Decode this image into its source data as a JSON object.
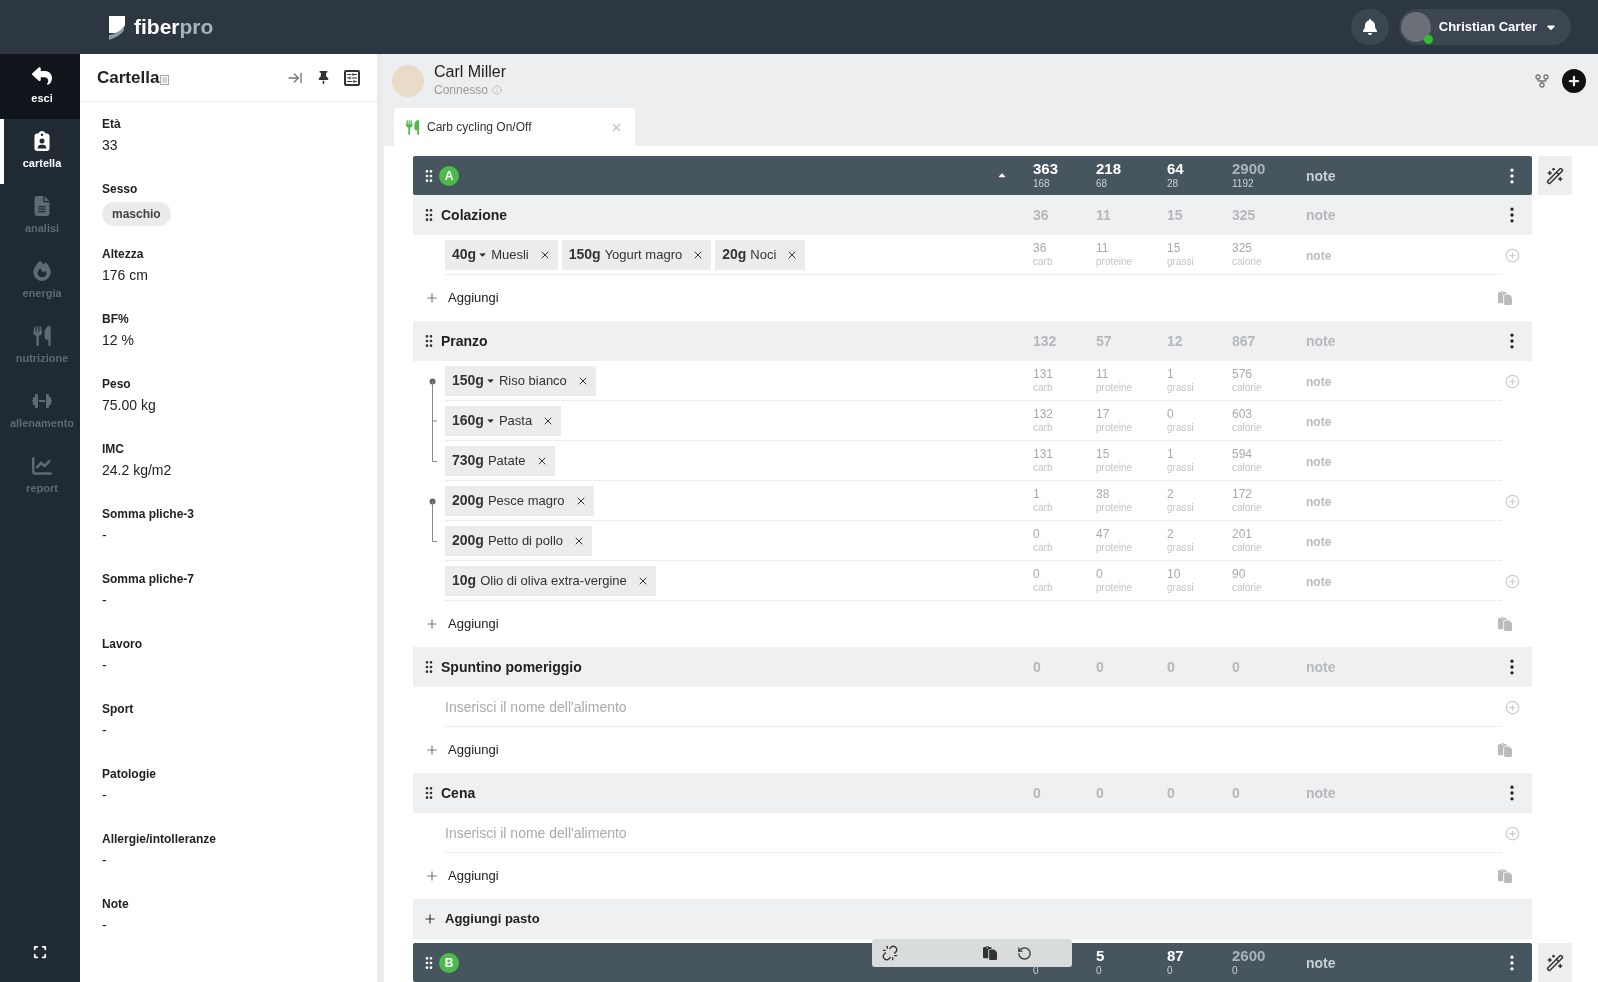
{
  "app": {
    "logo": "fiber",
    "logo_accent": "pro"
  },
  "user": {
    "name": "Christian Carter",
    "online": true
  },
  "nav": [
    {
      "label": "esci",
      "kind": "exit",
      "selected": false
    },
    {
      "label": "cartella",
      "kind": "record",
      "selected": true
    },
    {
      "label": "analisi",
      "kind": "analysis",
      "selected": false
    },
    {
      "label": "energia",
      "kind": "energy",
      "selected": false
    },
    {
      "label": "nutrizione",
      "kind": "nutrition",
      "selected": false
    },
    {
      "label": "allenamento",
      "kind": "training",
      "selected": false
    },
    {
      "label": "report",
      "kind": "report",
      "selected": false
    }
  ],
  "panel": {
    "title": "Cartella",
    "fields": [
      {
        "label": "Età",
        "value": "33"
      },
      {
        "label": "Sesso",
        "value": "maschio",
        "kind": "tag"
      },
      {
        "label": "Altezza",
        "value": "176 cm"
      },
      {
        "label": "BF%",
        "value": "12 %"
      },
      {
        "label": "Peso",
        "value": "75.00 kg"
      },
      {
        "label": "IMC",
        "value": "24.2 kg/m2"
      },
      {
        "label": "Somma pliche-3",
        "value": "-"
      },
      {
        "label": "Somma pliche-7",
        "value": "-"
      },
      {
        "label": "Lavoro",
        "value": "-"
      },
      {
        "label": "Sport",
        "value": "-"
      },
      {
        "label": "Patologie",
        "value": "-"
      },
      {
        "label": "Allergie/intolleranze",
        "value": "-"
      },
      {
        "label": "Note",
        "value": "-"
      }
    ]
  },
  "client": {
    "name": "Carl Miller",
    "status": "Connesso"
  },
  "tabs": [
    {
      "label": "Carb cycling On/Off",
      "selected": true
    }
  ],
  "plans": [
    {
      "letter": "A",
      "expanded": true,
      "note": "note",
      "totals": [
        {
          "value": "363",
          "sub": "168"
        },
        {
          "value": "218",
          "sub": "68"
        },
        {
          "value": "64",
          "sub": "28"
        },
        {
          "value": "2900",
          "sub": "1192",
          "kind": "calorie"
        }
      ],
      "meals": [
        {
          "name": "Colazione",
          "totals": [
            "36",
            "11",
            "15",
            "325"
          ],
          "note": "note",
          "add_label": "Aggiungi",
          "groups": [
            {
              "rows": [
                {
                  "chips": [
                    {
                      "qty": "40g",
                      "name": "Muesli",
                      "dropdown": true
                    },
                    {
                      "qty": "150g",
                      "name": "Yogurt magro",
                      "dropdown": false
                    },
                    {
                      "qty": "20g",
                      "name": "Noci",
                      "dropdown": false
                    }
                  ],
                  "note": "note",
                  "values": [
                    {
                      "value": "36",
                      "unit": "carb"
                    },
                    {
                      "value": "11",
                      "unit": "proteine"
                    },
                    {
                      "value": "15",
                      "unit": "grassi"
                    },
                    {
                      "value": "325",
                      "unit": "calorie"
                    }
                  ]
                }
              ]
            }
          ]
        },
        {
          "name": "Pranzo",
          "totals": [
            "132",
            "57",
            "12",
            "867"
          ],
          "note": "note",
          "add_label": "Aggiungi",
          "groups": [
            {
              "rows": [
                {
                  "chips": [
                    {
                      "qty": "150g",
                      "name": "Riso bianco",
                      "dropdown": true
                    }
                  ],
                  "note": "note",
                  "values": [
                    {
                      "value": "131",
                      "unit": "carb"
                    },
                    {
                      "value": "11",
                      "unit": "proteine"
                    },
                    {
                      "value": "1",
                      "unit": "grassi"
                    },
                    {
                      "value": "576",
                      "unit": "calorie"
                    }
                  ]
                },
                {
                  "chips": [
                    {
                      "qty": "160g",
                      "name": "Pasta",
                      "dropdown": true
                    }
                  ],
                  "note": "note",
                  "values": [
                    {
                      "value": "132",
                      "unit": "carb"
                    },
                    {
                      "value": "17",
                      "unit": "proteine"
                    },
                    {
                      "value": "0",
                      "unit": "grassi"
                    },
                    {
                      "value": "603",
                      "unit": "calorie"
                    }
                  ]
                },
                {
                  "chips": [
                    {
                      "qty": "730g",
                      "name": "Patate",
                      "dropdown": false
                    }
                  ],
                  "note": "note",
                  "values": [
                    {
                      "value": "131",
                      "unit": "carb"
                    },
                    {
                      "value": "15",
                      "unit": "proteine"
                    },
                    {
                      "value": "1",
                      "unit": "grassi"
                    },
                    {
                      "value": "594",
                      "unit": "calorie"
                    }
                  ]
                }
              ]
            },
            {
              "rows": [
                {
                  "chips": [
                    {
                      "qty": "200g",
                      "name": "Pesce magro",
                      "dropdown": false
                    }
                  ],
                  "note": "note",
                  "values": [
                    {
                      "value": "1",
                      "unit": "carb"
                    },
                    {
                      "value": "38",
                      "unit": "proteine"
                    },
                    {
                      "value": "2",
                      "unit": "grassi"
                    },
                    {
                      "value": "172",
                      "unit": "calorie"
                    }
                  ]
                },
                {
                  "chips": [
                    {
                      "qty": "200g",
                      "name": "Petto di pollo",
                      "dropdown": false
                    }
                  ],
                  "note": "note",
                  "values": [
                    {
                      "value": "0",
                      "unit": "carb"
                    },
                    {
                      "value": "47",
                      "unit": "proteine"
                    },
                    {
                      "value": "2",
                      "unit": "grassi"
                    },
                    {
                      "value": "201",
                      "unit": "calorie"
                    }
                  ]
                }
              ]
            },
            {
              "rows": [
                {
                  "chips": [
                    {
                      "qty": "10g",
                      "name": "Olio di oliva extra-vergine",
                      "dropdown": false
                    }
                  ],
                  "note": "note",
                  "values": [
                    {
                      "value": "0",
                      "unit": "carb"
                    },
                    {
                      "value": "0",
                      "unit": "proteine"
                    },
                    {
                      "value": "10",
                      "unit": "grassi"
                    },
                    {
                      "value": "90",
                      "unit": "calorie"
                    }
                  ]
                }
              ]
            }
          ]
        },
        {
          "name": "Spuntino pomeriggio",
          "totals": [
            "0",
            "0",
            "0",
            "0"
          ],
          "note": "note",
          "add_label": "Aggiungi",
          "placeholder": "Inserisci il nome dell'alimento"
        },
        {
          "name": "Cena",
          "totals": [
            "0",
            "0",
            "0",
            "0"
          ],
          "note": "note",
          "add_label": "Aggiungi",
          "placeholder": "Inserisci il nome dell'alimento"
        }
      ],
      "add_meal": "Aggiungi pasto"
    },
    {
      "letter": "B",
      "note": "note",
      "totals": [
        {
          "sub": "0"
        },
        {
          "value": "5",
          "sub": "0"
        },
        {
          "value": "87",
          "sub": "0"
        },
        {
          "value": "2600",
          "sub": "0",
          "kind": "calorie"
        }
      ]
    }
  ]
}
